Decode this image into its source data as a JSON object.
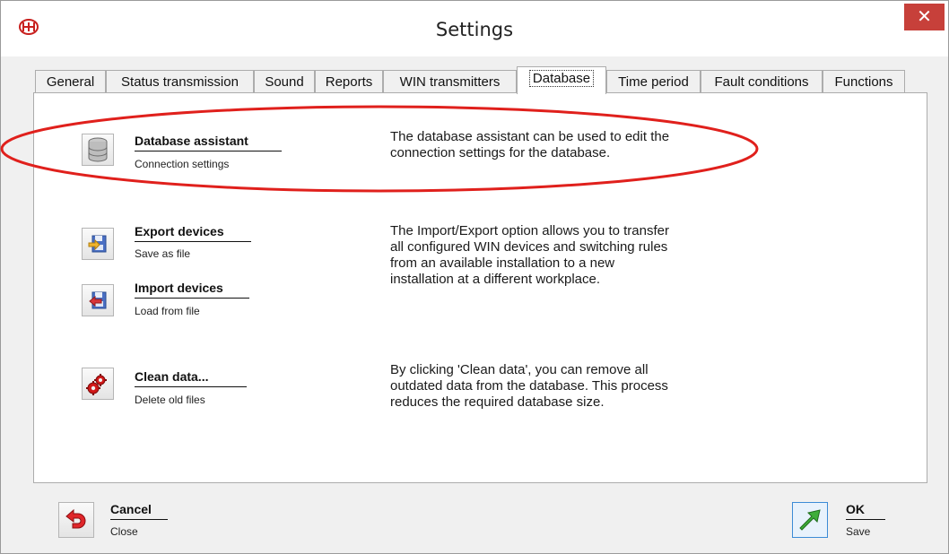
{
  "window": {
    "title": "Settings",
    "close_label": "✕",
    "app_icon_label": "W"
  },
  "tabs": [
    {
      "label": "General"
    },
    {
      "label": "Status transmission"
    },
    {
      "label": "Sound"
    },
    {
      "label": "Reports"
    },
    {
      "label": "WIN transmitters"
    },
    {
      "label": "Database"
    },
    {
      "label": "Time period"
    },
    {
      "label": "Fault conditions"
    },
    {
      "label": "Functions"
    }
  ],
  "active_tab": "Database",
  "database": {
    "assistant": {
      "title": "Database assistant",
      "subtitle": "Connection settings",
      "description": [
        "The database assistant can be used to edit the",
        "connection settings for the database."
      ],
      "icon": "database-icon"
    },
    "export": {
      "title": "Export devices",
      "subtitle": "Save as file",
      "icon": "export-disk-icon"
    },
    "import": {
      "title": "Import devices",
      "subtitle": "Load from file",
      "icon": "import-disk-icon"
    },
    "import_export_description": [
      "The Import/Export option allows you to transfer",
      "all configured WIN devices and switching rules",
      "from an available installation to a new",
      "installation at a different workplace."
    ],
    "clean": {
      "title": "Clean data...",
      "subtitle": "Delete old files",
      "description": [
        "By clicking 'Clean data', you can remove all",
        "outdated data from the database. This process",
        "reduces the required database size."
      ],
      "icon": "gears-icon"
    }
  },
  "footer": {
    "cancel": {
      "title": "Cancel",
      "subtitle": "Close",
      "icon": "undo-arrow-icon"
    },
    "ok": {
      "title": "OK",
      "subtitle": "Save",
      "icon": "green-arrow-icon"
    }
  },
  "colors": {
    "highlight_ellipse": "#e0201c",
    "close_button": "#c7403a",
    "accent_red": "#c8201e"
  }
}
